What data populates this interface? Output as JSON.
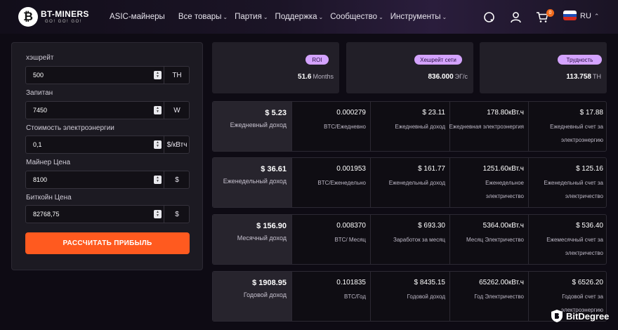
{
  "header": {
    "logo": {
      "glyph": "₿",
      "name": "BT-MINERS",
      "tagline": "GO! GO! GO!"
    },
    "nav": [
      {
        "label": "ASIC-майнеры",
        "dropdown": false
      },
      {
        "label": "Все товары",
        "dropdown": true
      },
      {
        "label": "Партия",
        "dropdown": true
      },
      {
        "label": "Поддержка",
        "dropdown": true
      },
      {
        "label": "Сообщество",
        "dropdown": true
      },
      {
        "label": "Инструменты",
        "dropdown": true
      }
    ],
    "icons": [
      "search-icon",
      "user-icon",
      "cart-icon"
    ],
    "cart_count": "0",
    "language": "RU",
    "flag_colors": [
      "#ffffff",
      "#1f4fb8",
      "#d52b1e"
    ]
  },
  "calculator": {
    "fields": [
      {
        "label": "хэшрейт",
        "value": "500",
        "unit": "TH"
      },
      {
        "label": "Запитан",
        "value": "7450",
        "unit": "W"
      },
      {
        "label": "Стоимость электроэнергии",
        "value": "0,1",
        "unit": "$/кВтч"
      },
      {
        "label": "Майнер Цена",
        "value": "8100",
        "unit": "$"
      },
      {
        "label": "Биткойн Цена",
        "value": "82768,75",
        "unit": "$"
      }
    ],
    "button_label": "РАССЧИТАТЬ ПРИБЫЛЬ"
  },
  "stats": [
    {
      "pill": "ROI",
      "value": "51.6",
      "unit": "Months"
    },
    {
      "pill": "Хешрейт сети",
      "value": "836.000",
      "unit": "ЭГ/с"
    },
    {
      "pill": "Трудность",
      "value": "113.758",
      "unit": "TH"
    }
  ],
  "results": [
    {
      "main": {
        "value": "$ 5.23",
        "label": "Ежедневный доход"
      },
      "cells": [
        {
          "value": "0.000279",
          "label": "BTC/Ежедневно"
        },
        {
          "value": "$ 23.11",
          "label": "Ежедневный доход"
        },
        {
          "value": "178.80кВт.ч",
          "label": "Ежедневная электроэнергия"
        },
        {
          "value": "$ 17.88",
          "label": "Ежедневный счет за электроэнергию"
        }
      ]
    },
    {
      "main": {
        "value": "$ 36.61",
        "label": "Еженедельный доход"
      },
      "cells": [
        {
          "value": "0.001953",
          "label": "BTC/Еженедельно"
        },
        {
          "value": "$ 161.77",
          "label": "Еженедельный доход"
        },
        {
          "value": "1251.60кВт.ч",
          "label": "Еженедельное электричество"
        },
        {
          "value": "$ 125.16",
          "label": "Еженедельный счет за электричество"
        }
      ]
    },
    {
      "main": {
        "value": "$ 156.90",
        "label": "Месячный доход"
      },
      "cells": [
        {
          "value": "0.008370",
          "label": "BTC/ Месяц"
        },
        {
          "value": "$ 693.30",
          "label": "Заработок за месяц"
        },
        {
          "value": "5364.00кВт.ч",
          "label": "Месяц Электричество"
        },
        {
          "value": "$ 536.40",
          "label": "Ежемесячный счет за электричество"
        }
      ]
    },
    {
      "main": {
        "value": "$ 1908.95",
        "label": "Годовой доход"
      },
      "cells": [
        {
          "value": "0.101835",
          "label": "BTC/Год"
        },
        {
          "value": "$ 8435.15",
          "label": "Годовой доход"
        },
        {
          "value": "65262.00кВт.ч",
          "label": "Год Электричество"
        },
        {
          "value": "$ 6526.20",
          "label": "Годовой счет за электроэнергию"
        }
      ]
    }
  ],
  "watermark": {
    "text": "BitDegree"
  },
  "colors": {
    "accent": "#ff5a1f",
    "pill": "#d4a3ff",
    "badge": "#f26a1b"
  }
}
